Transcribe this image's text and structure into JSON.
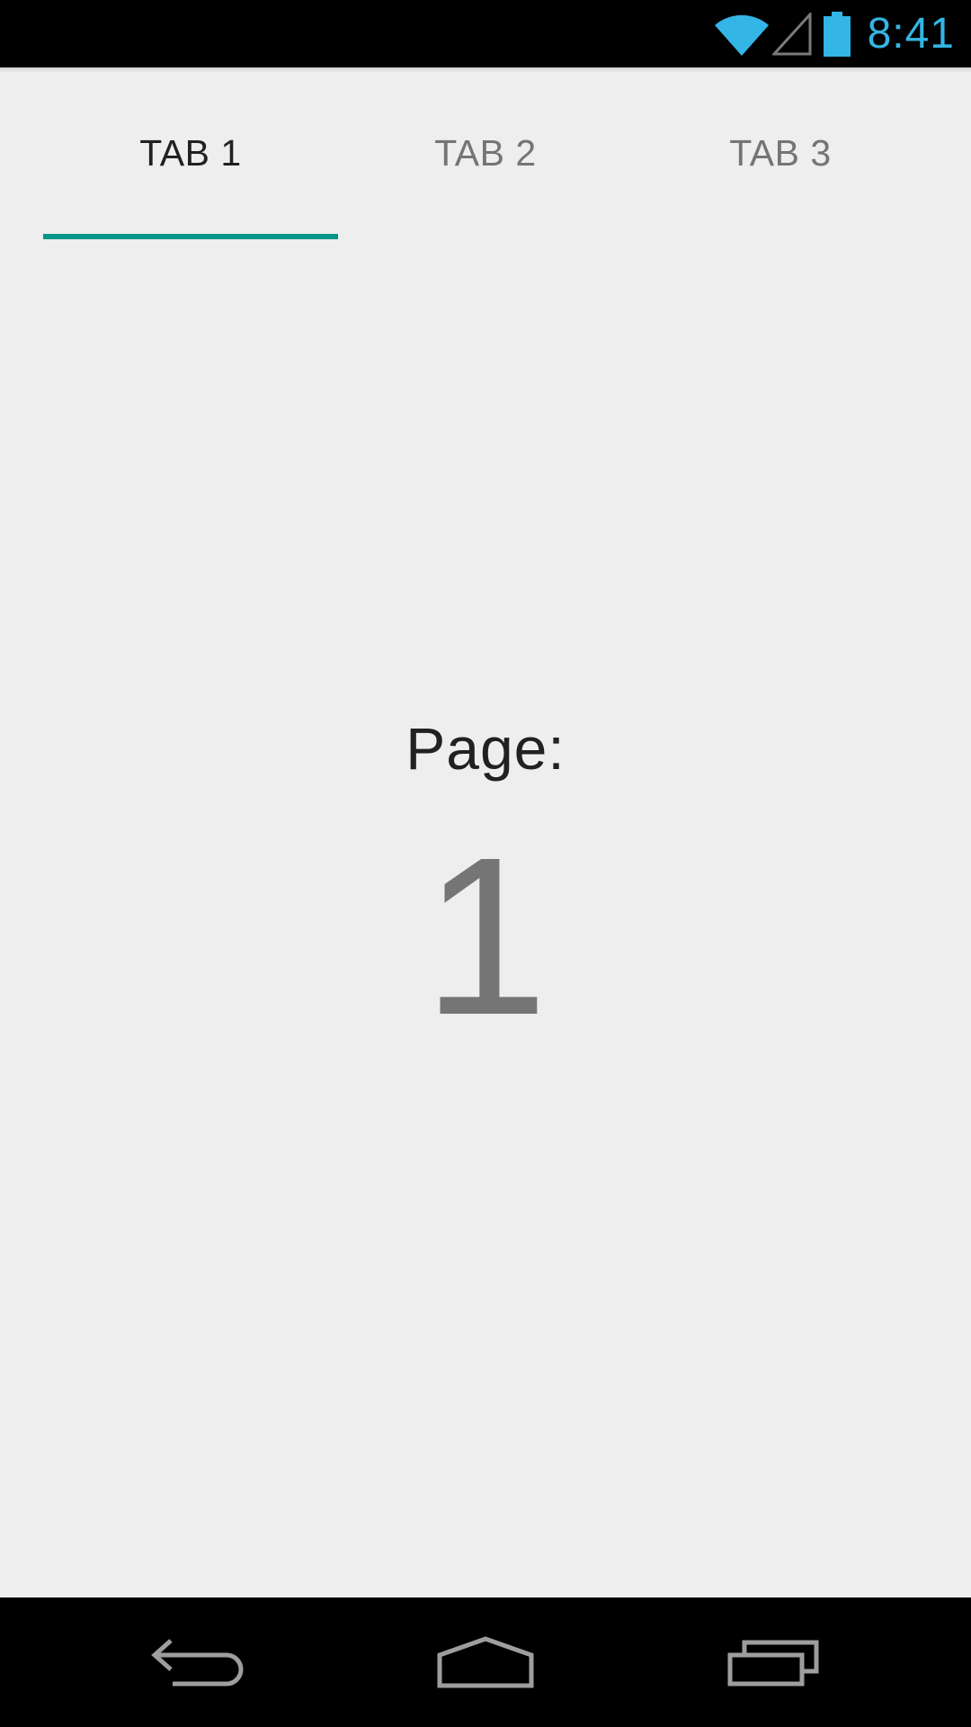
{
  "status_bar": {
    "time": "8:41",
    "icons": [
      "wifi-icon",
      "signal-icon",
      "battery-icon"
    ],
    "accent_color": "#33b5e5"
  },
  "tabs": [
    {
      "label": "TAB 1",
      "selected": true
    },
    {
      "label": "TAB 2",
      "selected": false
    },
    {
      "label": "TAB 3",
      "selected": false
    }
  ],
  "tab_indicator_color": "#009688",
  "content": {
    "page_label": "Page:",
    "page_number": "1"
  },
  "nav_bar": {
    "icons": [
      "back-icon",
      "home-icon",
      "recents-icon"
    ]
  }
}
